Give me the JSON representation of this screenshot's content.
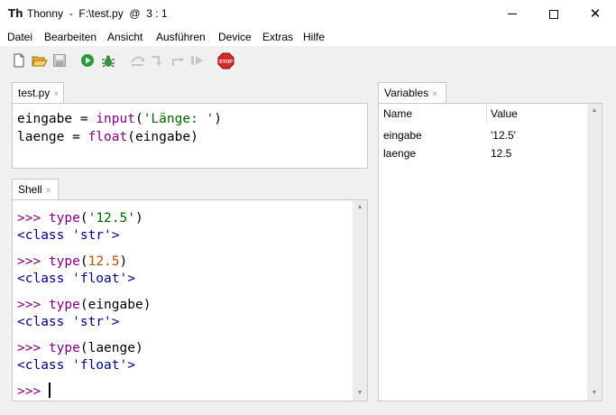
{
  "window": {
    "title": "Thonny  -  F:\\test.py  @  3 : 1",
    "app_icon": "Th"
  },
  "menu": [
    "Datei",
    "Bearbeiten",
    "Ansicht",
    "Ausführen",
    "Device",
    "Extras",
    "Hilfe"
  ],
  "toolbar": {
    "icons": [
      "new-file-icon",
      "open-folder-icon",
      "save-icon",
      "run-icon",
      "debug-icon",
      "step-over-icon",
      "step-into-icon",
      "step-out-icon",
      "resume-icon",
      "stop-icon"
    ],
    "stop_label": "STOP"
  },
  "editor": {
    "tab_label": "test.py",
    "close_glyph": "×",
    "lines": [
      {
        "a": "eingabe = ",
        "fn": "input",
        "b": "(",
        "str": "'Länge: '",
        "c": ")"
      },
      {
        "a": "laenge = ",
        "fn": "float",
        "b": "(eingabe)",
        "str": "",
        "c": ""
      }
    ]
  },
  "shell": {
    "tab_label": "Shell",
    "close_glyph": "×",
    "prompt": ">>>",
    "entries": [
      {
        "fn": "type",
        "open": "(",
        "arg": "'12.5'",
        "arg_type": "str",
        "close": ")",
        "output": "<class 'str'>"
      },
      {
        "fn": "type",
        "open": "(",
        "arg": "12.5",
        "arg_type": "num",
        "close": ")",
        "output": "<class 'float'>"
      },
      {
        "fn": "type",
        "open": "(",
        "arg": "eingabe",
        "arg_type": "plain",
        "close": ")",
        "output": "<class 'str'>"
      },
      {
        "fn": "type",
        "open": "(",
        "arg": "laenge",
        "arg_type": "plain",
        "close": ")",
        "output": "<class 'float'>"
      }
    ]
  },
  "variables": {
    "tab_label": "Variables",
    "close_glyph": "×",
    "col_name": "Name",
    "col_value": "Value",
    "rows": [
      {
        "name": "eingabe",
        "value": "'12.5'"
      },
      {
        "name": "laenge",
        "value": "12.5"
      }
    ]
  },
  "colors": {
    "keyword_call": "#800080",
    "string": "#006400",
    "number": "#b05000",
    "prompt": "#800080",
    "output": "#000080"
  }
}
